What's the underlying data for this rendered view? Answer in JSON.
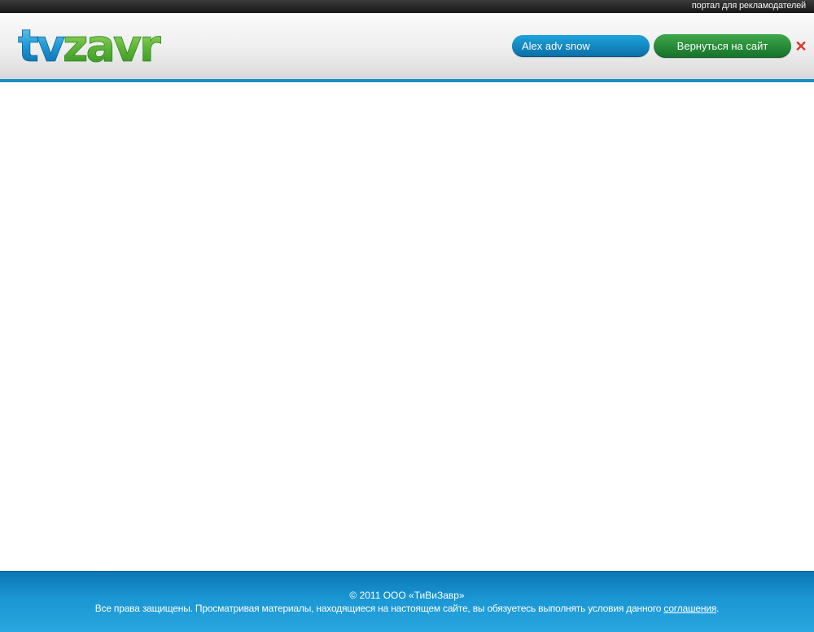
{
  "topbar": {
    "text": "портал для рекламодателей"
  },
  "header": {
    "logo_text": "tvzavr",
    "user_name": "Alex adv snow",
    "back_button": "Вернуться на сайт",
    "close_icon": "close-icon"
  },
  "colors": {
    "accent_blue": "#1c8fc8",
    "pill_blue": "#0a6ea6",
    "button_green": "#137129",
    "close_red": "#e0352b"
  },
  "footer": {
    "copyright": "© 2011 ООО «ТиВиЗавр»",
    "notice": "Все права защищены. Просматривая материалы, находящиеся на настоящем сайте, вы обязуетесь выполнять условия данного",
    "link_text": "соглашения",
    "period": "."
  }
}
